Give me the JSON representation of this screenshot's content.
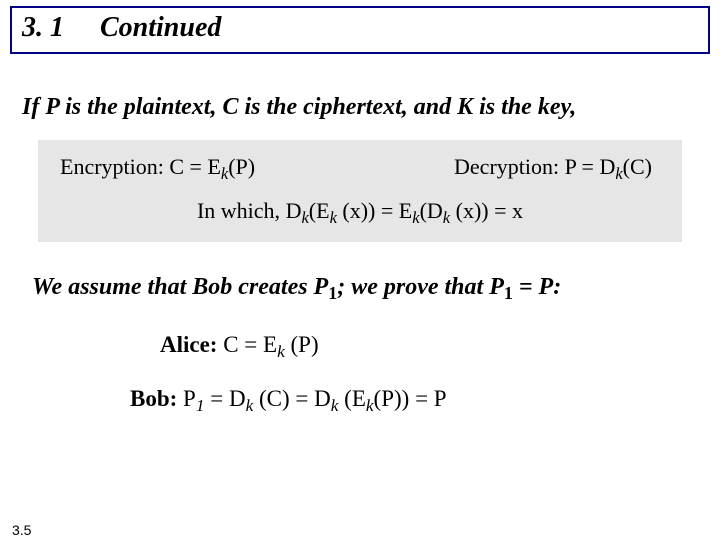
{
  "header": {
    "num": "3. 1",
    "title": "Continued"
  },
  "intro": "If P is the plaintext, C is the ciphertext, and K is the key,",
  "box": {
    "enc_label": "Encryption:",
    "enc_formula": "C = E",
    "enc_sub": "k",
    "enc_tail": "(P)",
    "dec_label": "Decryption:",
    "dec_formula": "P = D",
    "dec_sub": "k",
    "dec_tail": "(C)",
    "inwhich": "In which,",
    "id_d": "D",
    "id_e": "E",
    "id_k": "k",
    "id_x": "(x)",
    "id_eq": " = ",
    "id_open": "(",
    "id_close": ")",
    "id_closeclose": "))",
    "id_tail": " = x"
  },
  "assume": {
    "pre": "We assume that Bob creates P",
    "mid": "; we prove that P",
    "post": " = P:",
    "sub": "1"
  },
  "alice": {
    "label": "Alice:",
    "c": " C = E",
    "k": "k",
    "p": " (P)"
  },
  "bob": {
    "label": "Bob:",
    "p1": " P",
    "one": "1",
    "eqd": " = D",
    "k": "k",
    "cd": " (C) = D",
    "ek": " (E",
    "pp": "(P)) = P"
  },
  "pagefoot": "3.5"
}
